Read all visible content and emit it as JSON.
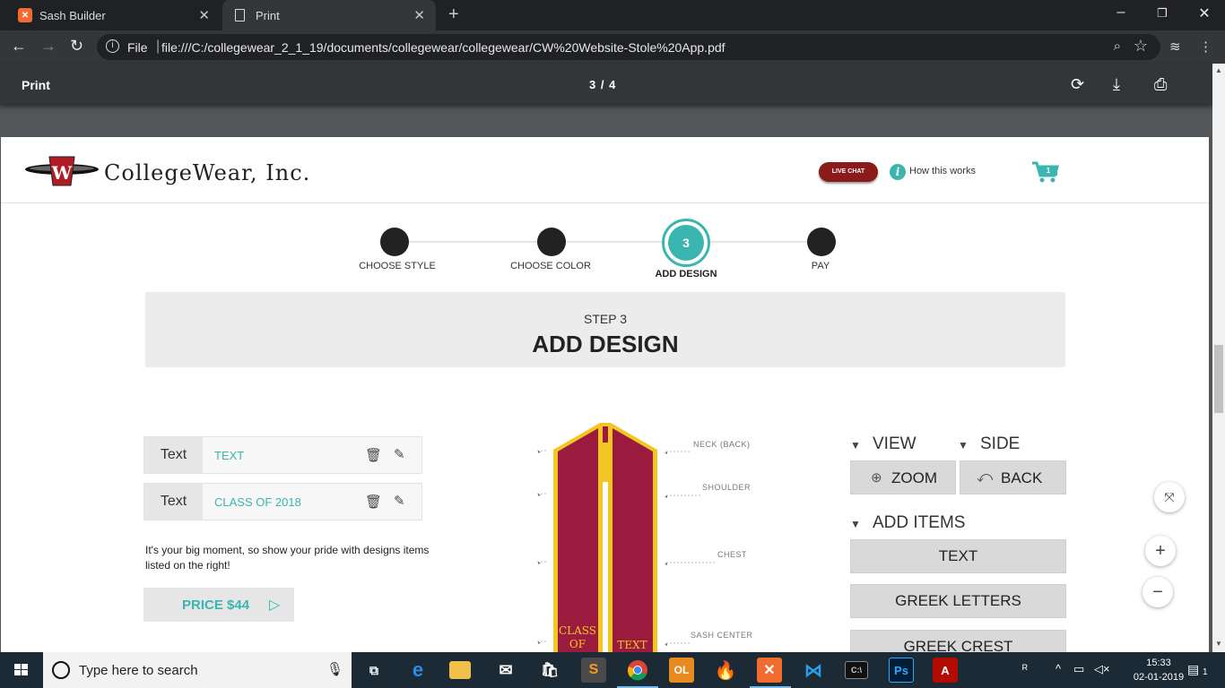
{
  "browser": {
    "tabs": [
      {
        "title": "Sash Builder",
        "active": false
      },
      {
        "title": "Print",
        "active": true
      }
    ],
    "address": {
      "scheme_label": "File",
      "url": "file:///C:/collegewear_2_1_19/documents/collegewear/collegewear/CW%20Website-Stole%20App.pdf"
    }
  },
  "pdf_viewer": {
    "title": "Print",
    "page_indicator": "3 / 4"
  },
  "site": {
    "brand": "CollegeWear, Inc.",
    "live_chat": "LIVE CHAT",
    "how_it_works": "How this works",
    "cart_count": "1",
    "steps": [
      {
        "label": "CHOOSE STYLE"
      },
      {
        "label": "CHOOSE COLOR"
      },
      {
        "label": "ADD DESIGN",
        "number": "3",
        "active": true
      },
      {
        "label": "PAY"
      }
    ],
    "banner": {
      "sub": "STEP 3",
      "title": "ADD DESIGN"
    },
    "text_items": [
      {
        "label": "Text",
        "value": "TEXT"
      },
      {
        "label": "Text",
        "value": "CLASS OF 2018"
      }
    ],
    "blurb": "It's your big moment, so show your pride with designs items listed on the right!",
    "price_button": "PRICE $44",
    "stole": {
      "left_text": "CLASS OF",
      "right_text": "TEXT",
      "annotations": [
        "NECK (BACK)",
        "SHOULDER",
        "CHEST",
        "SASH CENTER"
      ]
    },
    "view_panel": {
      "view_label": "VIEW",
      "side_label": "SIDE",
      "zoom_button": "ZOOM",
      "back_button": "BACK",
      "add_items_label": "ADD ITEMS",
      "add_buttons": [
        "TEXT",
        "GREEK LETTERS",
        "GREEK CREST"
      ]
    }
  },
  "taskbar": {
    "search_placeholder": "Type here to search",
    "time": "15:33",
    "date": "02-01-2019",
    "notifications": "1"
  },
  "colors": {
    "accent": "#3bb5b0",
    "stole_maroon": "#9b1b3f",
    "stole_gold": "#f3c623",
    "live_chat": "#8b1a1a"
  }
}
